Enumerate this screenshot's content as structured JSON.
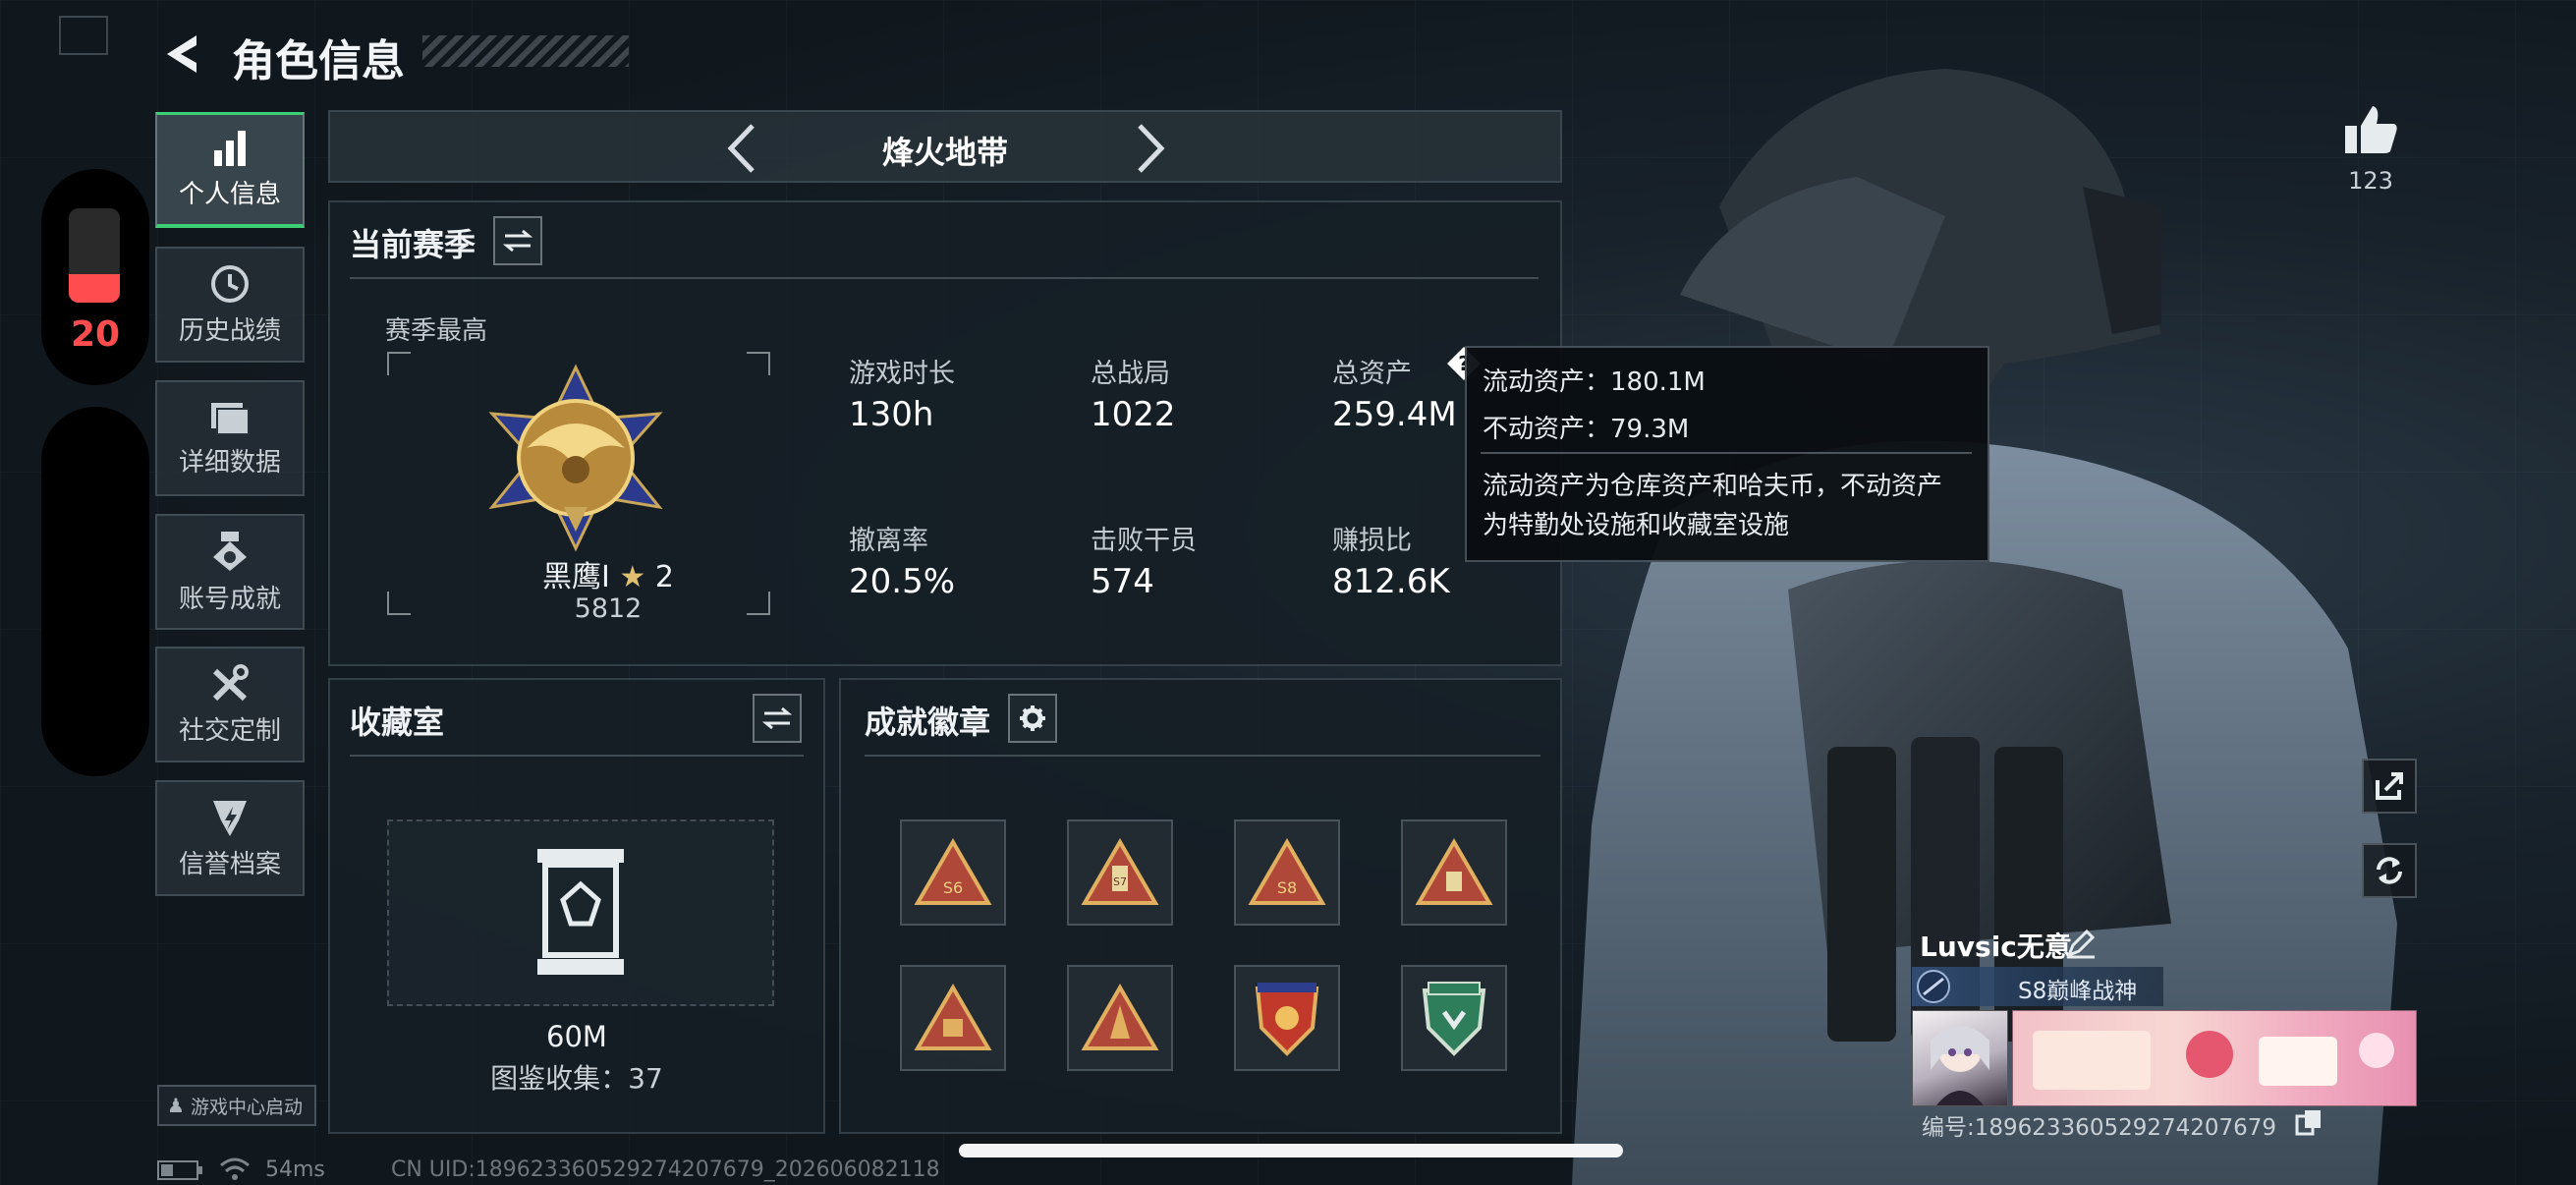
{
  "header": {
    "title": "角色信息"
  },
  "battery": {
    "level": "20",
    "fill_fraction": 0.3,
    "accent": "#ff4d4f"
  },
  "side_nav": {
    "items": [
      {
        "label": "个人信息",
        "icon": "bar-chart-icon"
      },
      {
        "label": "历史战绩",
        "icon": "history-icon"
      },
      {
        "label": "详细数据",
        "icon": "folder-icon"
      },
      {
        "label": "账号成就",
        "icon": "medal-icon"
      },
      {
        "label": "社交定制",
        "icon": "tools-icon"
      },
      {
        "label": "信誉档案",
        "icon": "credit-shield-icon"
      }
    ],
    "active_index": 0
  },
  "mode_selector": {
    "label": "烽火地带"
  },
  "season": {
    "title": "当前赛季",
    "best_label": "赛季最高",
    "rank_name": "黑鹰I",
    "rank_stars": "2",
    "rank_score": "5812",
    "stats": [
      {
        "label": "游戏时长",
        "value": "130h"
      },
      {
        "label": "总战局",
        "value": "1022"
      },
      {
        "label": "总资产",
        "value": "259.4M"
      },
      {
        "label": "撤离率",
        "value": "20.5%"
      },
      {
        "label": "击败干员",
        "value": "574"
      },
      {
        "label": "赚损比",
        "value": "812.6K"
      }
    ]
  },
  "tooltip": {
    "liquid": "流动资产：180.1M",
    "fixed": "不动资产：79.3M",
    "desc_line1": "流动资产为仓库资产和哈夫币，不动资产",
    "desc_line2": "为特勤处设施和收藏室设施"
  },
  "collection": {
    "title": "收藏室",
    "value": "60M",
    "catalog": "图鉴收集：37"
  },
  "achievements": {
    "title": "成就徽章",
    "badges": [
      "S6",
      "S7",
      "S8",
      "",
      "",
      "",
      "",
      ""
    ]
  },
  "likes": {
    "count": "123"
  },
  "player": {
    "name": "Luvsic无意",
    "title": "S8巅峰战神",
    "id_label": "编号:18962336052927420767​9"
  },
  "status_bar": {
    "ping": "54ms",
    "uid": "CN UID:18962336052927420767​9_202606082118",
    "game_center": "游戏中心启动"
  }
}
